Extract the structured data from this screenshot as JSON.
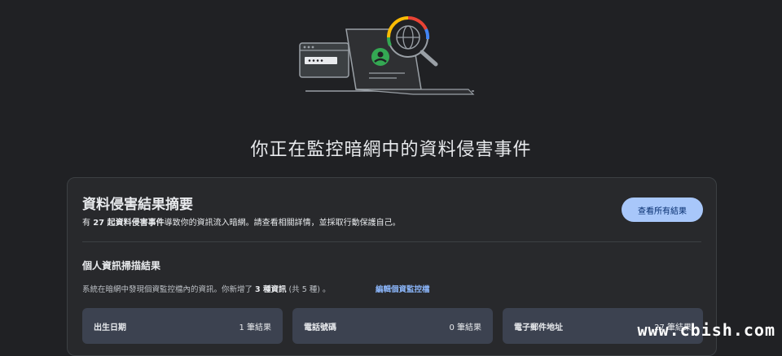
{
  "page_title": "你正在監控暗網中的資料侵害事件",
  "summary": {
    "title": "資料侵害結果摘要",
    "desc_prefix": "有 ",
    "desc_bold": "27 起資料侵害事件",
    "desc_suffix": "導致你的資訊流入暗網。請查看相關詳情，並採取行動保護自己。",
    "view_all_label": "查看所有結果"
  },
  "scan": {
    "title": "個人資訊掃描結果",
    "desc_prefix": "系統在暗網中發現個資監控檔內的資訊。你新增了 ",
    "desc_bold": "3 種資訊",
    "desc_suffix": " (共 5 種) 。",
    "edit_link": "編輯個資監控檔"
  },
  "tiles": [
    {
      "label": "出生日期",
      "count": "1 筆結果"
    },
    {
      "label": "電話號碼",
      "count": "0 筆結果"
    },
    {
      "label": "電子郵件地址",
      "count": "27 筆結果"
    }
  ],
  "watermark": "www.cbish.com",
  "colors": {
    "background": "#202124",
    "card": "#28292c",
    "accent_button": "#a8c7fa",
    "link": "#8ab4f8",
    "tile": "#3c4250"
  },
  "icons": {
    "hero": "laptop-magnifier-globe-illustration"
  }
}
